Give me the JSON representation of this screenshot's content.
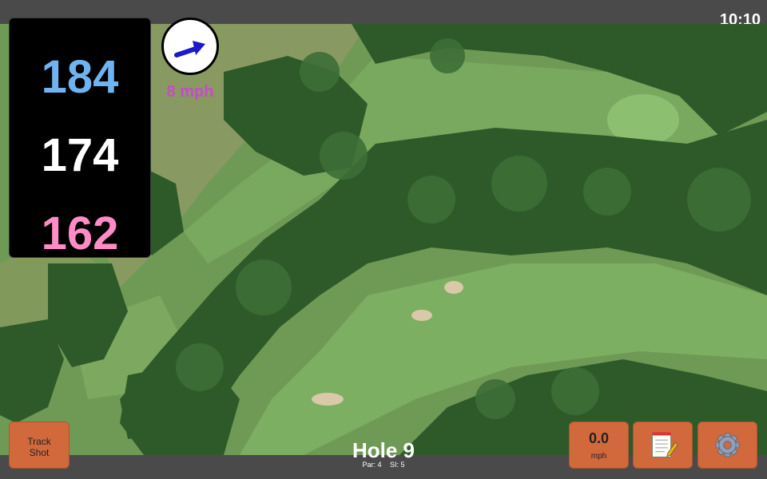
{
  "status": {
    "time": "10:10"
  },
  "distances": {
    "back": "184",
    "middle": "174",
    "front": "162",
    "colors": {
      "back": "#6fb3f0",
      "middle": "#ffffff",
      "front": "#ff8cc6"
    }
  },
  "wind": {
    "speed": "8 mph",
    "arrow_color": "#1a1acc",
    "speed_color": "#c64bc9"
  },
  "buttons": {
    "track_shot_line1": "Track",
    "track_shot_line2": "Shot",
    "speed_value": "0.0",
    "speed_unit": "mph",
    "notes_icon": "notepad-icon",
    "settings_icon": "gear-icon",
    "color": "#d2693c"
  },
  "hole": {
    "title": "Hole 9",
    "par": "Par: 4",
    "si": "SI: 5"
  },
  "map": {
    "type": "satellite-golf-hole"
  }
}
